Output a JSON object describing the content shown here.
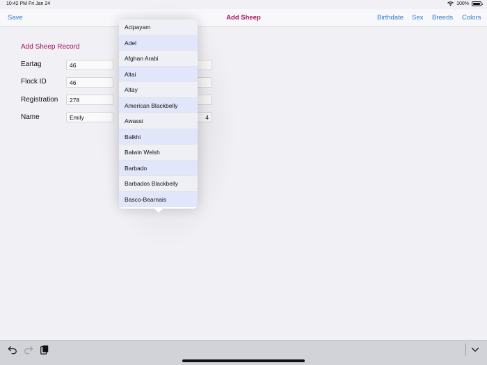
{
  "status": {
    "time": "10:42 PM",
    "date": "Fri Jan 24",
    "battery": "100%"
  },
  "navbar": {
    "save_label": "Save",
    "title": "Add Sheep",
    "birthdate_label": "Birthdate",
    "sex_label": "Sex",
    "breeds_label": "Breeds",
    "colors_label": "Colors"
  },
  "form": {
    "title": "Add Sheep Record",
    "fields": [
      {
        "label": "Eartag",
        "value": "46",
        "right_value": ""
      },
      {
        "label": "Flock ID",
        "value": "46",
        "right_value": ""
      },
      {
        "label": "Registration",
        "value": "278",
        "right_value": ""
      },
      {
        "label": "Name",
        "value": "Emily",
        "right_value": "4"
      }
    ]
  },
  "breeds": [
    "Acipayam",
    "Adel",
    "Afghan Arabi",
    "Altai",
    "Altay",
    "American Blackbelly",
    "Awassi",
    "Balkhi",
    "Balwin Welsh",
    "Barbado",
    "Barbados Blackbelly",
    "Basco-Bearnais"
  ],
  "colors": {
    "accent": "#a3135b",
    "link": "#2f7ad6",
    "row_odd": "#eef0f5",
    "row_even": "#e2e6fb"
  }
}
